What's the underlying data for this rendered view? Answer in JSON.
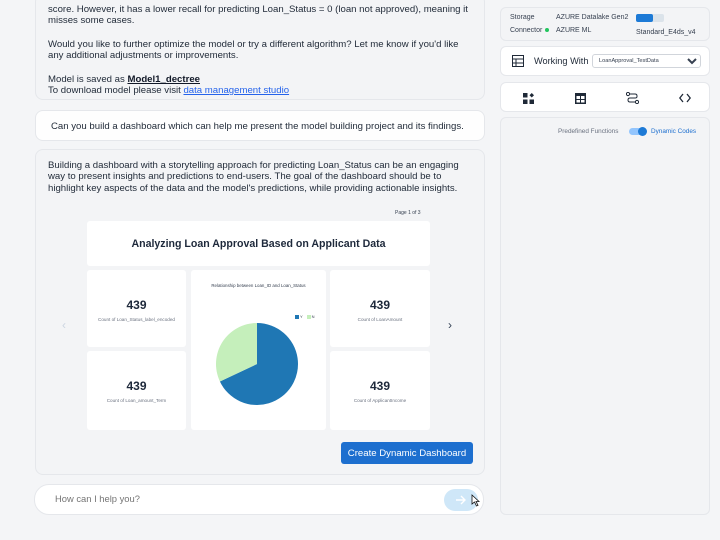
{
  "chat": {
    "msg1": {
      "line1": "score. However, it has a lower recall for predicting Loan_Status = 0 (loan not approved), meaning it misses some cases.",
      "line2": "Would you like to further optimize the model or try a different algorithm? Let me know if you'd like any additional adjustments or improvements.",
      "saved_prefix": "Model is saved as",
      "model_name": "Model1_dectree",
      "download_prefix": "To download model please visit",
      "download_link": "data management studio"
    },
    "user_question": "Can you build a dashboard which can help me present the model building project and its findings.",
    "msg2": "Building a dashboard with a storytelling approach for predicting Loan_Status can be an engaging way to present insights and predictions to end-users. The goal of the dashboard should be to highlight key aspects of the data and the model's predictions, while providing actionable insights."
  },
  "dashboard": {
    "page_indicator": "Page 1 of 3",
    "title": "Analyzing Loan Approval Based on Applicant Data",
    "cards": [
      {
        "value": "439",
        "label": "Count of Loan_Status_label_encoded"
      },
      {
        "value": "439",
        "label": "Count of LoanAmount"
      },
      {
        "value": "439",
        "label": "Count of Loan_amount_Term"
      },
      {
        "value": "439",
        "label": "Count of ApplicantIncome"
      }
    ],
    "nav_prev": "‹",
    "nav_next": "›",
    "create_button": "Create Dynamic Dashboard"
  },
  "chart_data": {
    "type": "pie",
    "title": "Relationship between Loan_ID and Loan_Status",
    "categories": [
      "Y",
      "N"
    ],
    "values": [
      68,
      32
    ],
    "colors": [
      "#1f77b4",
      "#c5efbb"
    ],
    "legend": "top-right"
  },
  "input": {
    "placeholder": "How can I help you?",
    "send_icon": "arrow-right-icon"
  },
  "sidebar": {
    "storage_label": "Storage",
    "storage_value": "AZURE Datalake Gen2",
    "storage_usage_fraction": 0.6,
    "connector_label": "Connector",
    "connector_value": "AZURE ML",
    "compute_value": "Standard_E4ds_v4",
    "working_with_label": "Working With",
    "working_with_value": "LoanApproval_TestData",
    "tool_icons": [
      "widgets-icon",
      "table-icon",
      "flow-icon",
      "code-icon"
    ],
    "predefined_label": "Predefined Functions",
    "dynamic_label": "Dynamic Codes"
  },
  "colors": {
    "accent": "#1d6fcf",
    "pie_y": "#1f77b4",
    "pie_n": "#c5efbb",
    "status_green": "#22c55e"
  }
}
